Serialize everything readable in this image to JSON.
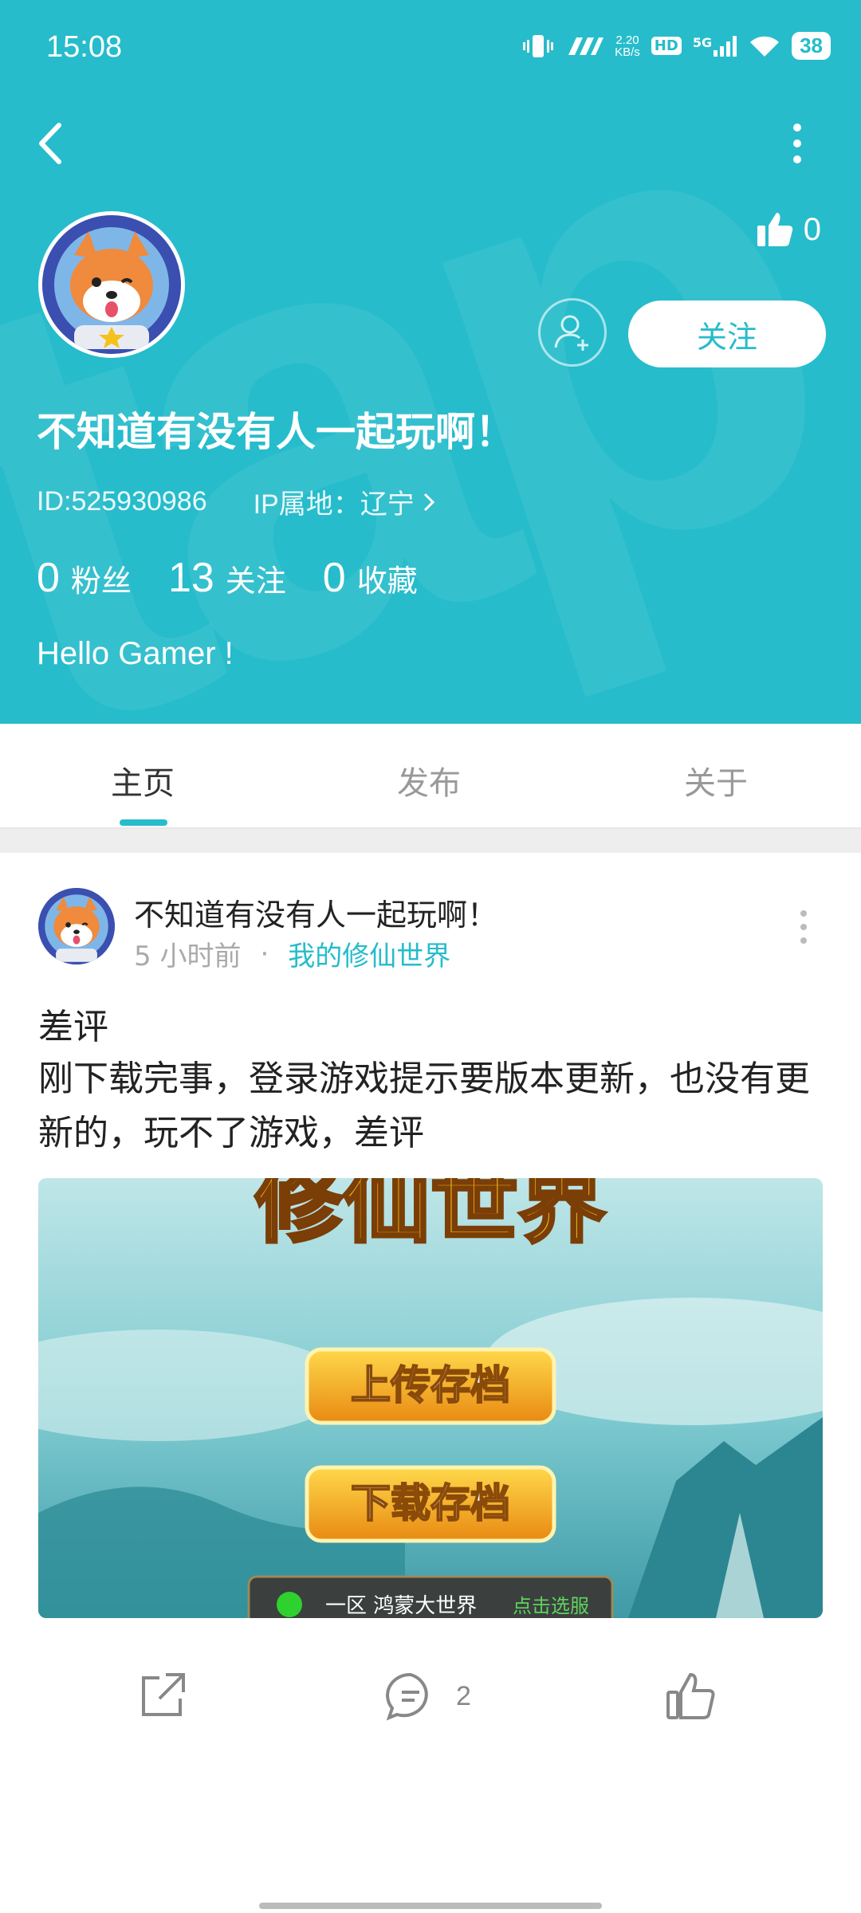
{
  "status_bar": {
    "time": "15:08",
    "network_speed": "2.20\nKB/s",
    "hd": "HD",
    "signal": "5G",
    "battery": "38"
  },
  "profile": {
    "likes_count": "0",
    "follow_label": "关注",
    "username": "不知道有没有人一起玩啊！",
    "id_text": "ID:525930986",
    "ip_text": "IP属地：辽宁",
    "stats": [
      {
        "num": "0",
        "label": "粉丝"
      },
      {
        "num": "13",
        "label": "关注"
      },
      {
        "num": "0",
        "label": "收藏"
      }
    ],
    "bio": "Hello Gamer !"
  },
  "tabs": [
    {
      "label": "主页",
      "active": true
    },
    {
      "label": "发布",
      "active": false
    },
    {
      "label": "关于",
      "active": false
    }
  ],
  "post": {
    "author": "不知道有没有人一起玩啊！",
    "time_ago": "5 小时前",
    "game": "我的修仙世界",
    "title": "差评",
    "body": "刚下载完事，登录游戏提示要版本更新，也没有更新的，玩不了游戏，差评",
    "image": {
      "title": "修仙世界",
      "upload_button": "上传存档",
      "download_button": "下载存档",
      "server_name": "一区 鸿蒙大世界",
      "server_action": "点击选服"
    },
    "comment_count": "2"
  },
  "colors": {
    "accent": "#26bccb",
    "muted": "#999999",
    "separator": "#eeeeee"
  }
}
